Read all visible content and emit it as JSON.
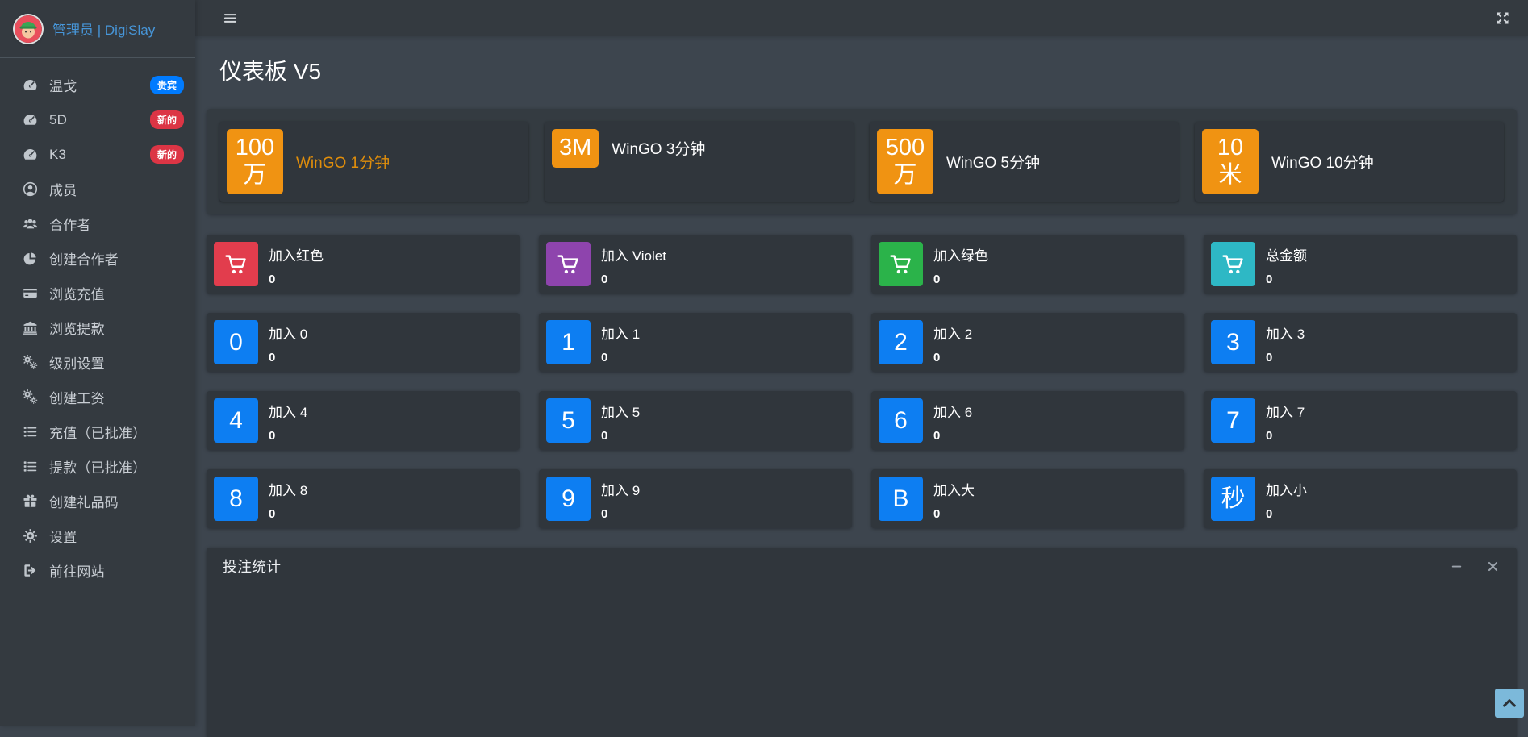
{
  "app": {
    "brand": "管理员 | DigiSlay",
    "brand_color": "#4796d9"
  },
  "sidebar": {
    "items": [
      {
        "label": "温戈",
        "icon": "gauge-icon",
        "badge": "贵宾",
        "badge_color": "#007bff"
      },
      {
        "label": "5D",
        "icon": "gauge-icon",
        "badge": "新的",
        "badge_color": "#dc3545"
      },
      {
        "label": "K3",
        "icon": "gauge-icon",
        "badge": "新的",
        "badge_color": "#dc3545"
      },
      {
        "label": "成员",
        "icon": "user-icon"
      },
      {
        "label": "合作者",
        "icon": "users-icon"
      },
      {
        "label": "创建合作者",
        "icon": "pie-chart-icon"
      },
      {
        "label": "浏览充值",
        "icon": "credit-card-icon"
      },
      {
        "label": "浏览提款",
        "icon": "bank-icon"
      },
      {
        "label": "级别设置",
        "icon": "cogs-icon"
      },
      {
        "label": "创建工资",
        "icon": "cogs-icon"
      },
      {
        "label": "充值（已批准）",
        "icon": "list-icon"
      },
      {
        "label": "提款（已批准）",
        "icon": "list-icon"
      },
      {
        "label": "创建礼品码",
        "icon": "gift-icon"
      },
      {
        "label": "设置",
        "icon": "gear-icon"
      },
      {
        "label": "前往网站",
        "icon": "sign-out-icon"
      }
    ]
  },
  "page": {
    "title": "仪表板 V5"
  },
  "info_boxes": [
    {
      "icon_text": "100万",
      "icon_color": "#f09312",
      "label": "WinGO 1分钟",
      "label_color": "#e08e0b"
    },
    {
      "icon_text": "3M",
      "icon_color": "#f09312",
      "label": "WinGO 3分钟",
      "label_color": "#ffffff"
    },
    {
      "icon_text": "500万",
      "icon_color": "#f09312",
      "label": "WinGO 5分钟",
      "label_color": "#ffffff"
    },
    {
      "icon_text": "10米",
      "icon_color": "#f09312",
      "label": "WinGO 10分钟",
      "label_color": "#ffffff"
    }
  ],
  "stat_cards": [
    {
      "kind": "cart",
      "title": "加入红色",
      "value": "0",
      "icon_color": "#e23d4d"
    },
    {
      "kind": "cart",
      "title": "加入 Violet",
      "value": "0",
      "icon_color": "#8e44ad"
    },
    {
      "kind": "cart",
      "title": "加入绿色",
      "value": "0",
      "icon_color": "#2bb34a"
    },
    {
      "kind": "cart",
      "title": "总金额",
      "value": "0",
      "icon_color": "#2eb8c5"
    },
    {
      "kind": "tile",
      "icon_text": "0",
      "title": "加入 0",
      "value": "0",
      "icon_color": "#0d7ef2"
    },
    {
      "kind": "tile",
      "icon_text": "1",
      "title": "加入 1",
      "value": "0",
      "icon_color": "#0d7ef2"
    },
    {
      "kind": "tile",
      "icon_text": "2",
      "title": "加入 2",
      "value": "0",
      "icon_color": "#0d7ef2"
    },
    {
      "kind": "tile",
      "icon_text": "3",
      "title": "加入 3",
      "value": "0",
      "icon_color": "#0d7ef2"
    },
    {
      "kind": "tile",
      "icon_text": "4",
      "title": "加入 4",
      "value": "0",
      "icon_color": "#0d7ef2"
    },
    {
      "kind": "tile",
      "icon_text": "5",
      "title": "加入 5",
      "value": "0",
      "icon_color": "#0d7ef2"
    },
    {
      "kind": "tile",
      "icon_text": "6",
      "title": "加入 6",
      "value": "0",
      "icon_color": "#0d7ef2"
    },
    {
      "kind": "tile",
      "icon_text": "7",
      "title": "加入 7",
      "value": "0",
      "icon_color": "#0d7ef2"
    },
    {
      "kind": "tile",
      "icon_text": "8",
      "title": "加入 8",
      "value": "0",
      "icon_color": "#0d7ef2"
    },
    {
      "kind": "tile",
      "icon_text": "9",
      "title": "加入 9",
      "value": "0",
      "icon_color": "#0d7ef2"
    },
    {
      "kind": "tile",
      "icon_text": "B",
      "title": "加入大",
      "value": "0",
      "icon_color": "#0d7ef2"
    },
    {
      "kind": "tile",
      "icon_text": "秒",
      "title": "加入小",
      "value": "0",
      "icon_color": "#0d7ef2"
    }
  ],
  "panel": {
    "title": "投注统计"
  },
  "colors": {
    "sidebar_bg": "#343a40",
    "navbar_bg": "#343a40",
    "content_bg": "#3d454e",
    "card_bg": "#30363c",
    "section_bg": "#343b41",
    "orange": "#f09312",
    "blue_tile": "#0d7ef2",
    "badge_vip": "#007bff",
    "badge_new": "#dc3545",
    "scroll_top_bg": "#7cb9da"
  }
}
